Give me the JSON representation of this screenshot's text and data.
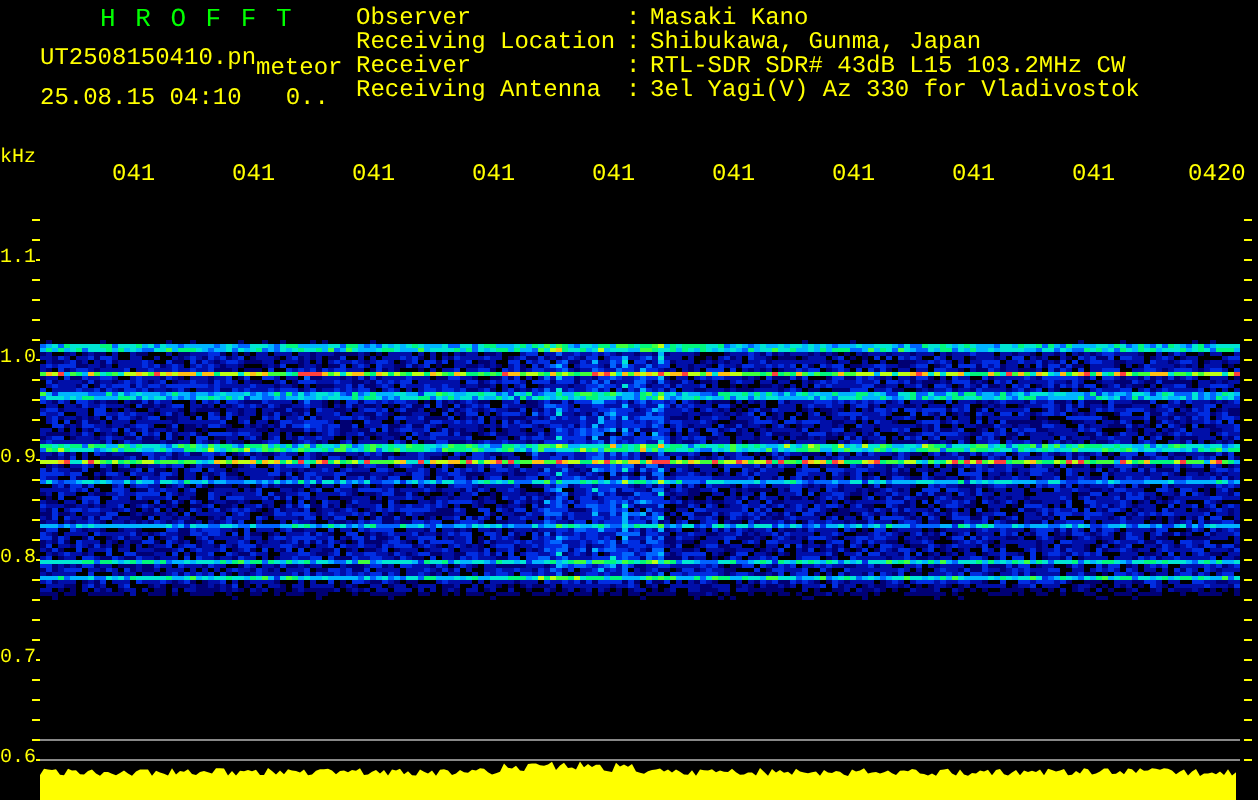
{
  "title": "H R O F F T",
  "file_name": "UT2508150410.pn",
  "mode": "meteor",
  "date_time": "25.08.15 04:10",
  "counter": "0..",
  "info": [
    {
      "label": "Observer",
      "sep": ":",
      "value": "Masaki Kano"
    },
    {
      "label": "Receiving Location",
      "sep": ":",
      "value": "Shibukawa, Gunma, Japan"
    },
    {
      "label": "Receiver",
      "sep": ":",
      "value": "RTL-SDR SDR# 43dB L15 103.2MHz CW"
    },
    {
      "label": "Receiving Antenna",
      "sep": ":",
      "value": "3el Yagi(V) Az 330 for Vladivostok"
    }
  ],
  "y_unit": "kHz",
  "time_labels": [
    "041",
    "041",
    "041",
    "041",
    "041",
    "041",
    "041",
    "041",
    "041",
    "0420"
  ],
  "freq_labels": [
    "1.1",
    "1.0",
    "0.9",
    "0.8",
    "0.7",
    "0.6"
  ]
}
